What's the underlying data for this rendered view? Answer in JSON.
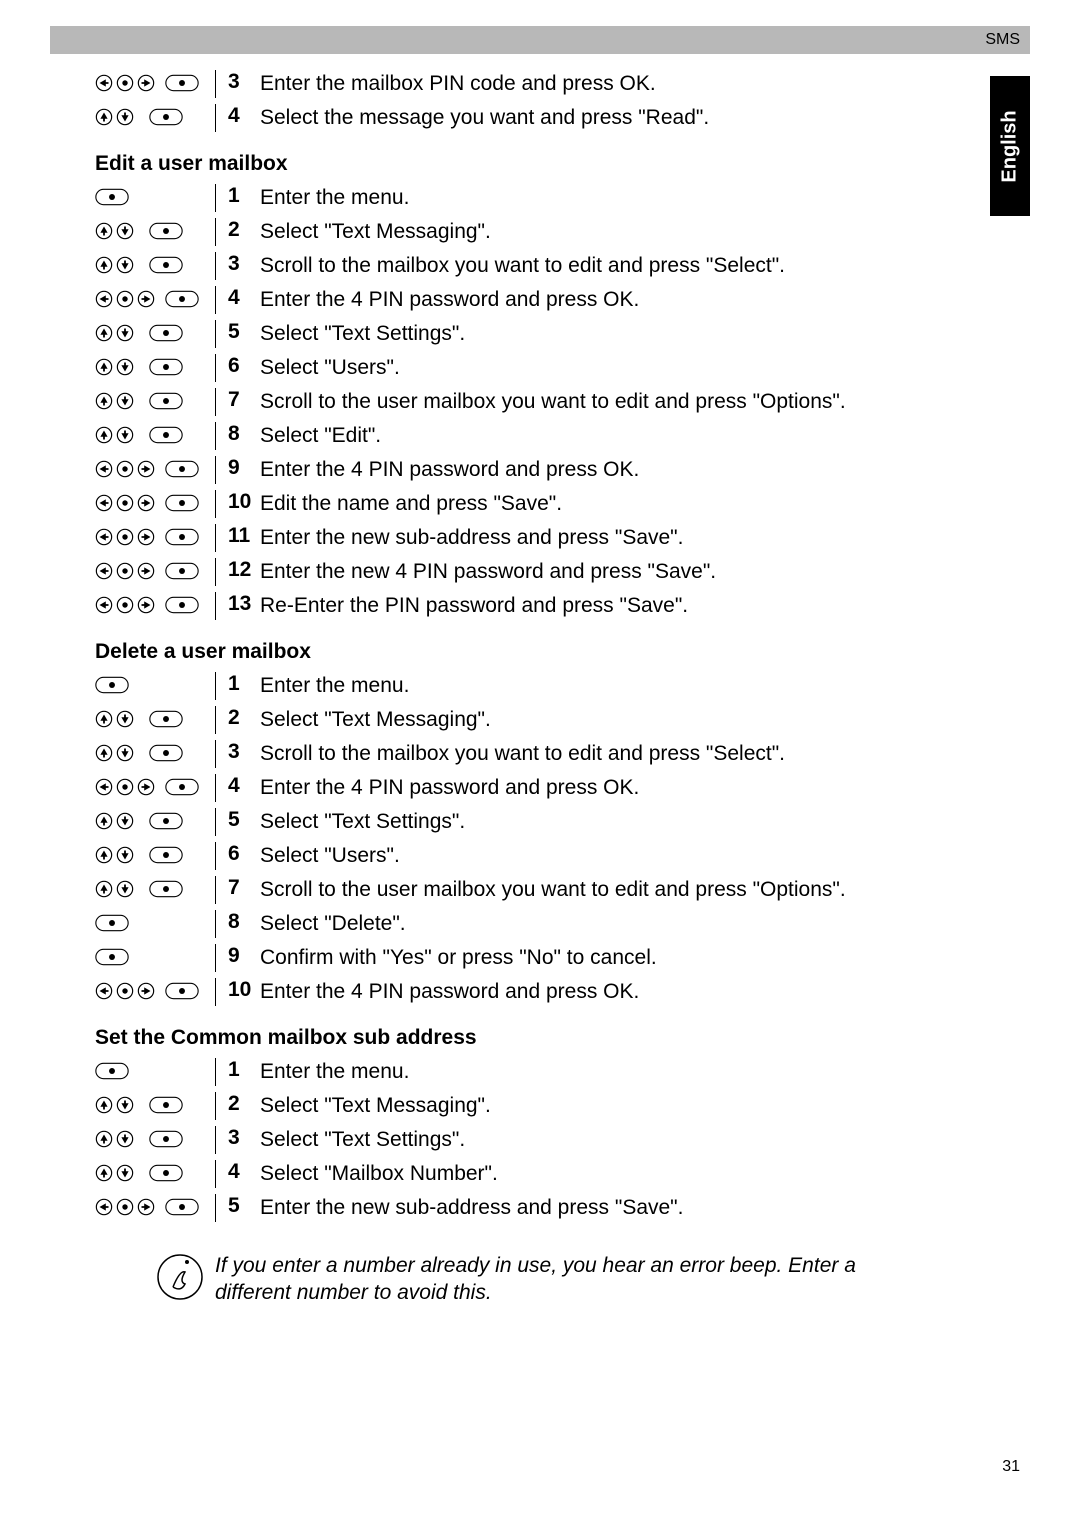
{
  "header": {
    "section": "SMS"
  },
  "sideTab": "English",
  "pageNumber": "31",
  "topSteps": [
    {
      "num": "3",
      "text": "Enter the mailbox PIN code and press OK.",
      "iconSet": "lrr_ok"
    },
    {
      "num": "4",
      "text": "Select the message you want and press \"Read\".",
      "iconSet": "ud_ok"
    }
  ],
  "section1": {
    "title": "Edit a user mailbox",
    "steps": [
      {
        "num": "1",
        "text": "Enter the menu.",
        "iconSet": "ok"
      },
      {
        "num": "2",
        "text": "Select \"Text Messaging\".",
        "iconSet": "ud_ok"
      },
      {
        "num": "3",
        "text": "Scroll to the mailbox you want to edit and press \"Select\".",
        "iconSet": "ud_ok"
      },
      {
        "num": "4",
        "text": "Enter the 4 PIN password and press OK.",
        "iconSet": "lrr_ok"
      },
      {
        "num": "5",
        "text": "Select \"Text Settings\".",
        "iconSet": "ud_ok"
      },
      {
        "num": "6",
        "text": "Select \"Users\".",
        "iconSet": "ud_ok"
      },
      {
        "num": "7",
        "text": "Scroll to the user mailbox you want to edit and press \"Options\".",
        "iconSet": "ud_ok"
      },
      {
        "num": "8",
        "text": "Select \"Edit\".",
        "iconSet": "ud_ok"
      },
      {
        "num": "9",
        "text": "Enter the 4 PIN password and press OK.",
        "iconSet": "lrr_ok"
      },
      {
        "num": "10",
        "text": "Edit the name and press \"Save\".",
        "iconSet": "lrr_ok"
      },
      {
        "num": "11",
        "text": "Enter the new sub-address and press \"Save\".",
        "iconSet": "lrr_ok"
      },
      {
        "num": "12",
        "text": "Enter the new 4 PIN password and press \"Save\".",
        "iconSet": "lrr_ok"
      },
      {
        "num": "13",
        "text": "Re-Enter the PIN password and press \"Save\".",
        "iconSet": "lrr_ok"
      }
    ]
  },
  "section2": {
    "title": "Delete a user mailbox",
    "steps": [
      {
        "num": "1",
        "text": "Enter the menu.",
        "iconSet": "ok"
      },
      {
        "num": "2",
        "text": "Select \"Text Messaging\".",
        "iconSet": "ud_ok"
      },
      {
        "num": "3",
        "text": "Scroll to the mailbox you want to edit and press \"Select\".",
        "iconSet": "ud_ok"
      },
      {
        "num": "4",
        "text": "Enter the 4 PIN password and press OK.",
        "iconSet": "lrr_ok"
      },
      {
        "num": "5",
        "text": "Select \"Text Settings\".",
        "iconSet": "ud_ok"
      },
      {
        "num": "6",
        "text": "Select \"Users\".",
        "iconSet": "ud_ok"
      },
      {
        "num": "7",
        "text": "Scroll to the user mailbox you want to edit and press \"Options\".",
        "iconSet": "ud_ok"
      },
      {
        "num": "8",
        "text": "Select \"Delete\".",
        "iconSet": "ok"
      },
      {
        "num": "9",
        "text": "Confirm with \"Yes\" or press \"No\" to cancel.",
        "iconSet": "ok"
      },
      {
        "num": "10",
        "text": "Enter the 4 PIN password and press OK.",
        "iconSet": "lrr_ok"
      }
    ]
  },
  "section3": {
    "title": "Set the Common mailbox sub address",
    "steps": [
      {
        "num": "1",
        "text": "Enter the menu.",
        "iconSet": "ok"
      },
      {
        "num": "2",
        "text": "Select \"Text Messaging\".",
        "iconSet": "ud_ok"
      },
      {
        "num": "3",
        "text": "Select \"Text Settings\".",
        "iconSet": "ud_ok"
      },
      {
        "num": "4",
        "text": "Select \"Mailbox Number\".",
        "iconSet": "ud_ok"
      },
      {
        "num": "5",
        "text": "Enter the new sub-address and press \"Save\".",
        "iconSet": "lrr_ok"
      }
    ]
  },
  "note": {
    "text": "If you enter a number already in use, you hear an error beep. Enter a different number to avoid this."
  }
}
